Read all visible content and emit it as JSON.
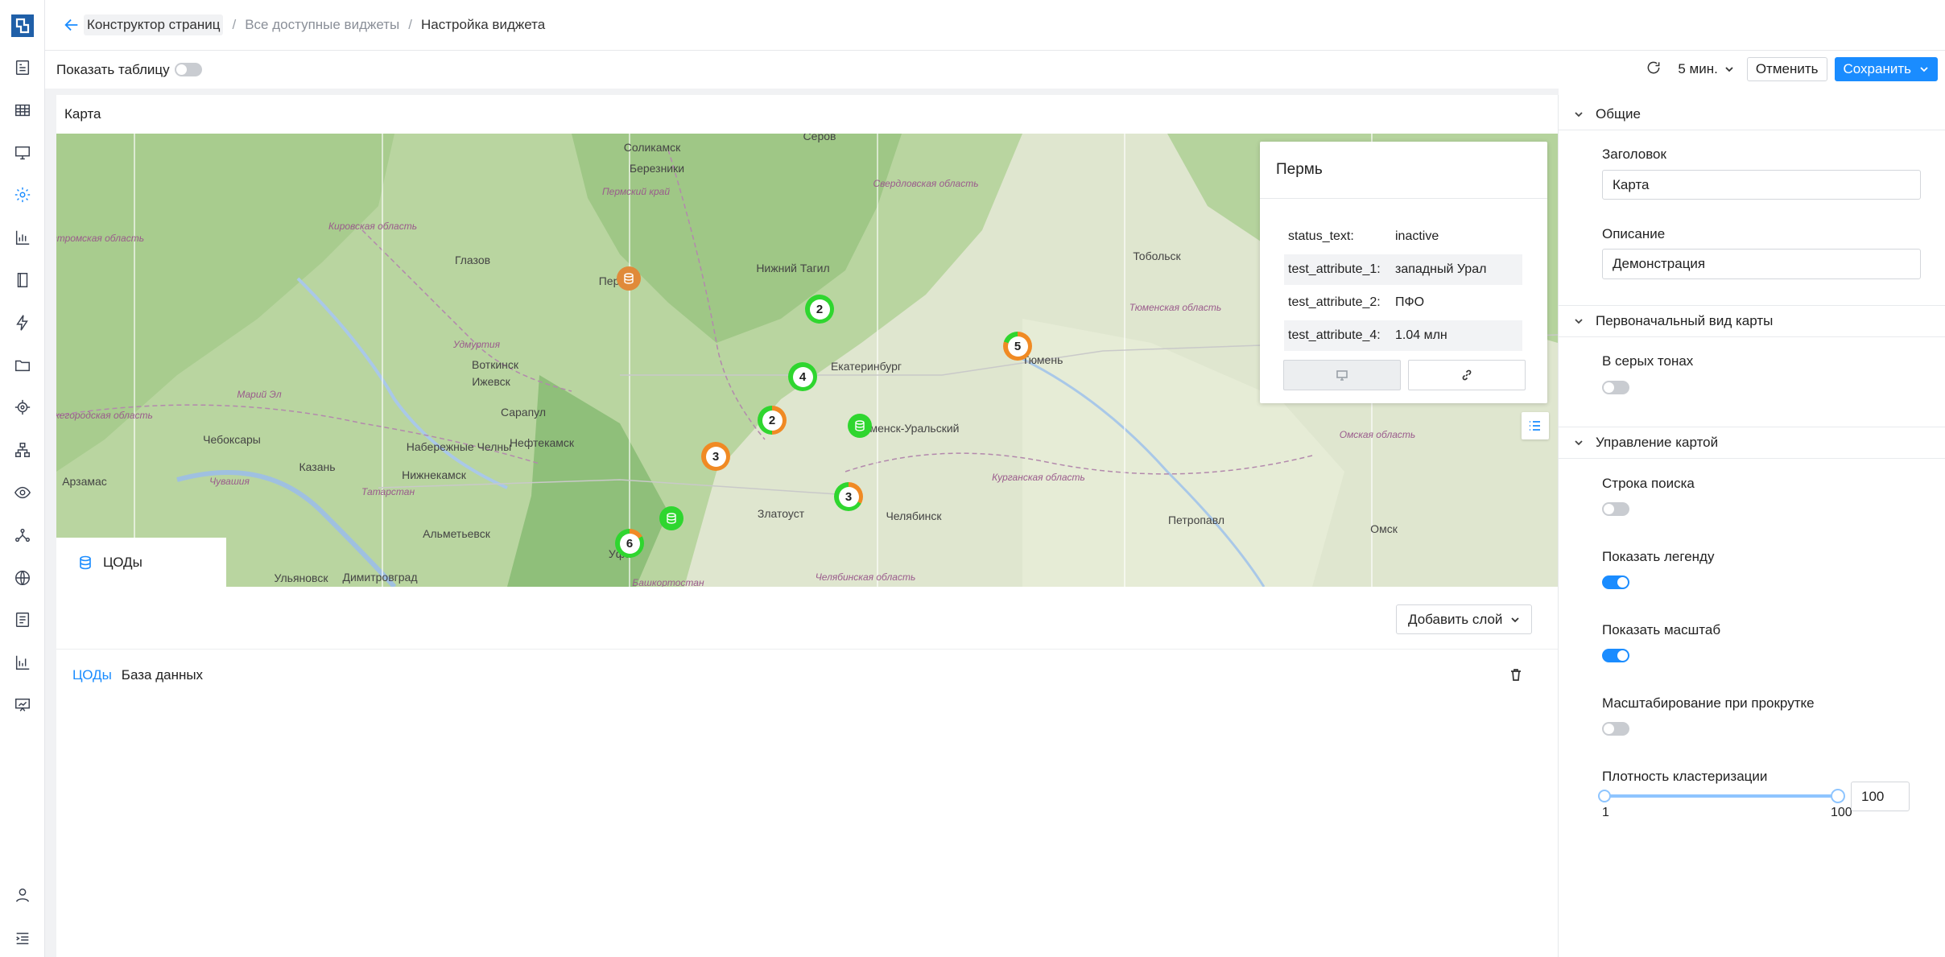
{
  "breadcrumb": {
    "page_builder": "Конструктор страниц",
    "all_widgets": "Все доступные виджеты",
    "current": "Настройка виджета"
  },
  "toolbar": {
    "show_table_label": "Показать таблицу",
    "show_table_on": false,
    "interval": "5 мин.",
    "cancel_label": "Отменить",
    "save_label": "Сохранить"
  },
  "widget": {
    "title": "Карта"
  },
  "map": {
    "cities": [
      "Пермь",
      "Ижевск",
      "Сарапул",
      "Нефтекамск",
      "Набережные Челны",
      "Чебоксары",
      "Казань",
      "Нижнекамск",
      "Альметьевск",
      "Ульяновск",
      "Димитровград",
      "Арзамас",
      "Глазов",
      "Воткинск",
      "Соликамск",
      "Березники",
      "Серов",
      "Нижний Тагил",
      "Екатеринбург",
      "Каменск-Уральский",
      "Златоуст",
      "Челябинск",
      "Тюмень",
      "Тобольск",
      "Петропавл",
      "Омск",
      "Уфа"
    ],
    "regions": [
      "Пермский край",
      "Кировская область",
      "Костромская область",
      "Удмуртия",
      "Марий Эл",
      "Нижегородская область",
      "Чувашия",
      "Татарстан",
      "Свердловская область",
      "Тюменская область",
      "Курганская область",
      "Омская область",
      "Челябинская область",
      "Башкортостан"
    ],
    "clusters": [
      {
        "count": "2",
        "ring": "#2fd62f"
      },
      {
        "count": "4",
        "ring": "#2fd62f"
      },
      {
        "count": "5",
        "ring": "#f08a24"
      },
      {
        "count": "2",
        "ring": "#f08a24"
      },
      {
        "count": "3",
        "ring": "#f08a24"
      },
      {
        "count": "3",
        "ring": "#2fd62f"
      },
      {
        "count": "6",
        "ring": "#2fd62f"
      }
    ],
    "popup": {
      "title": "Пермь",
      "rows": [
        {
          "key": "status_text:",
          "value": "inactive"
        },
        {
          "key": "test_attribute_1:",
          "value": "западный Урал"
        },
        {
          "key": "test_attribute_2:",
          "value": "ПФО"
        },
        {
          "key": "test_attribute_4:",
          "value": "1.04 млн"
        }
      ]
    },
    "legend_label": "ЦОДы"
  },
  "layers": {
    "add_label": "Добавить слой",
    "items": [
      {
        "name": "ЦОДы",
        "type": "База данных"
      }
    ]
  },
  "settings": {
    "general": {
      "section": "Общие",
      "title_label": "Заголовок",
      "title_value": "Карта",
      "description_label": "Описание",
      "description_value": "Демонстрация"
    },
    "initial_view": {
      "section": "Первоначальный вид карты",
      "grayscale_label": "В серых тонах",
      "grayscale_on": false
    },
    "controls": {
      "section": "Управление картой",
      "search_label": "Строка поиска",
      "search_on": false,
      "legend_label": "Показать легенду",
      "legend_on": true,
      "scale_label": "Показать масштаб",
      "scale_on": true,
      "scroll_zoom_label": "Масштабирование при прокрутке",
      "scroll_zoom_on": false,
      "cluster_density_label": "Плотность кластеризации",
      "cluster_min": "1",
      "cluster_max": "100",
      "cluster_value": "100"
    }
  },
  "colors": {
    "accent": "#1a8cff",
    "cluster_green": "#2fd62f",
    "cluster_orange": "#f08a24"
  }
}
